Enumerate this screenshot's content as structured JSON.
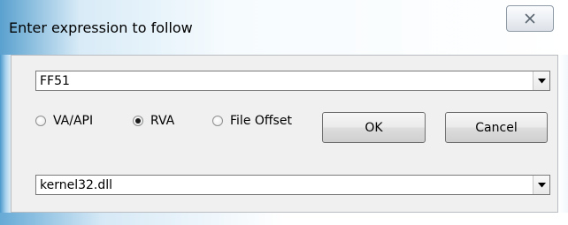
{
  "dialog": {
    "title": "Enter expression to follow",
    "close_glyph": "close-icon"
  },
  "expression": {
    "value": "FF51"
  },
  "address_mode": {
    "options": [
      {
        "label": "VA/API",
        "selected": false
      },
      {
        "label": "RVA",
        "selected": true
      },
      {
        "label": "File Offset",
        "selected": false
      }
    ]
  },
  "buttons": {
    "ok_label": "OK",
    "cancel_label": "Cancel"
  },
  "module": {
    "value": "kernel32.dll"
  },
  "colors": {
    "frame_accent": "#5aa1cf",
    "client_bg": "#f0f0f0"
  }
}
